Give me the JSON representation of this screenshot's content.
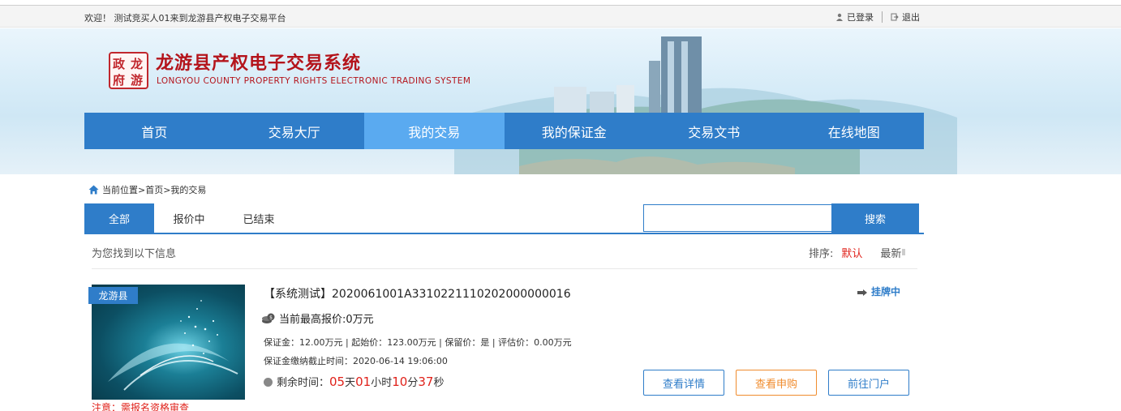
{
  "topbar": {
    "welcome": "欢迎！ 测试竞买人01来到龙游县产权电子交易平台",
    "logged_in": "已登录",
    "logout": "退出"
  },
  "banner": {
    "seal_chars": [
      "政",
      "龙",
      "府",
      "游"
    ],
    "title": "龙游县产权电子交易系统",
    "subtitle": "LONGYOU COUNTY PROPERTY RIGHTS ELECTRONIC TRADING SYSTEM"
  },
  "nav": {
    "items": [
      "首页",
      "交易大厅",
      "我的交易",
      "我的保证金",
      "交易文书",
      "在线地图"
    ],
    "active_index": 2
  },
  "breadcrumb": {
    "text": "当前位置>首页>我的交易"
  },
  "tabs": {
    "items": [
      "全部",
      "报价中",
      "已结束"
    ],
    "active_index": 0
  },
  "search": {
    "value": "",
    "placeholder": "",
    "button": "搜索"
  },
  "results": {
    "found_text": "为您找到以下信息",
    "sort_label": "排序:",
    "sort_default": "默认",
    "sort_newest": "最新"
  },
  "listing": {
    "region_tag": "龙游县",
    "title": "【系统测试】2020061001A3310221110202000000016",
    "status": "挂牌中",
    "bid_label": "当前最高报价:",
    "bid_value": "0万元",
    "info_line": "保证金：12.00万元 | 起始价：123.00万元 | 保留价：是 | 评估价：0.00万元",
    "deadline_line": "保证金缴纳截止时间：2020-06-14 19:06:00",
    "remain_label": "剩余时间：",
    "remain": {
      "days": "05",
      "days_unit": "天",
      "hours": "01",
      "hours_unit": "小时",
      "minutes": "10",
      "minutes_unit": "分",
      "seconds": "37",
      "seconds_unit": "秒"
    },
    "note": "注意：需报名资格审查",
    "buttons": {
      "detail": "查看详情",
      "apply": "查看申购",
      "portal": "前往门户"
    }
  },
  "colors": {
    "primary": "#2f7dc9",
    "nav_active": "#5aaaf0",
    "brand_red": "#b4141b",
    "highlight_red": "#e0221b",
    "orange": "#f08c2e"
  }
}
